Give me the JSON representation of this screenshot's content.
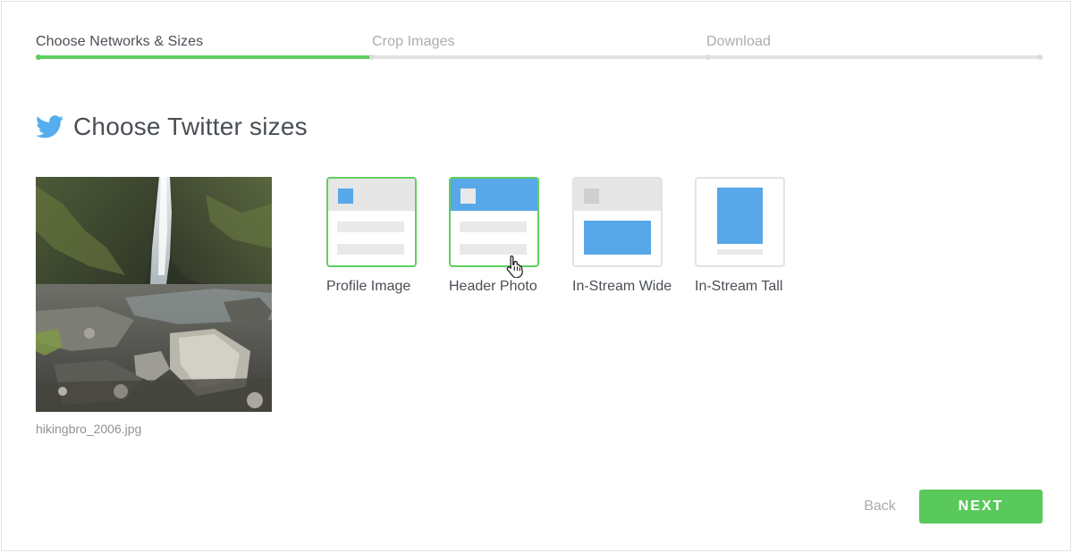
{
  "steps": [
    {
      "label": "Choose Networks & Sizes",
      "state": "active"
    },
    {
      "label": "Crop Images",
      "state": "inactive"
    },
    {
      "label": "Download",
      "state": "inactive"
    }
  ],
  "progress": {
    "completed_steps": 1,
    "total_steps": 3
  },
  "heading": {
    "icon": "twitter-bird-icon",
    "title": "Choose Twitter sizes"
  },
  "photo": {
    "filename": "hikingbro_2006.jpg"
  },
  "sizes": [
    {
      "label": "Profile Image",
      "selected": true
    },
    {
      "label": "Header Photo",
      "selected": true
    },
    {
      "label": "In-Stream Wide",
      "selected": false
    },
    {
      "label": "In-Stream Tall",
      "selected": false
    }
  ],
  "footer": {
    "back_label": "Back",
    "next_label": "NEXT"
  },
  "colors": {
    "accent_green": "#5fcf5f",
    "next_button": "#59c95b",
    "twitter_blue": "#55acee",
    "illustration_blue": "#57a7e9",
    "text": "#4a4f55",
    "muted_text": "#a9adb2"
  }
}
